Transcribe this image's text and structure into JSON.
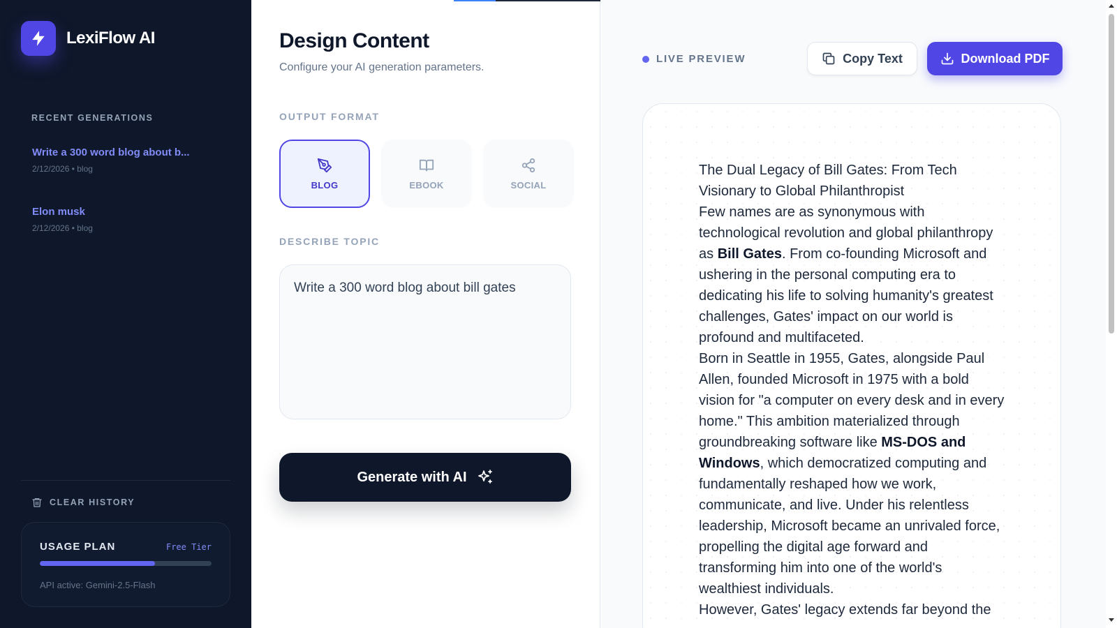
{
  "app": {
    "name": "LexiFlow AI",
    "logo_icon": "bolt-icon"
  },
  "sidebar": {
    "section_label": "RECENT GENERATIONS",
    "history": [
      {
        "title": "Write a 300 word blog about b...",
        "date": "2/12/2026",
        "type": "blog",
        "meta": "2/12/2026 • blog"
      },
      {
        "title": "Elon musk",
        "date": "2/12/2026",
        "type": "blog",
        "meta": "2/12/2026 • blog"
      }
    ],
    "clear_history_label": "CLEAR HISTORY",
    "usage": {
      "title": "USAGE PLAN",
      "tier": "Free Tier",
      "progress": 0.67,
      "api": "API active: Gemini-2.5-Flash"
    }
  },
  "config": {
    "title": "Design Content",
    "subtitle": "Configure your AI generation parameters.",
    "output_format_label": "OUTPUT FORMAT",
    "formats": [
      {
        "label": "BLOG",
        "icon": "pen-nib-icon",
        "active": true
      },
      {
        "label": "EBOOK",
        "icon": "book-icon",
        "active": false
      },
      {
        "label": "SOCIAL",
        "icon": "share-icon",
        "active": false
      }
    ],
    "topic_label": "DESCRIBE TOPIC",
    "topic_value": "Write a 300 word blog about bill gates",
    "generate_label": "Generate with AI"
  },
  "preview": {
    "live_label": "LIVE PREVIEW",
    "copy_label": "Copy Text",
    "download_label": "Download PDF",
    "doc": {
      "title": "The Dual Legacy of Bill Gates: From Tech Visionary to Global Philanthropist",
      "p1_before": "Few names are as synonymous with technological revolution and global philanthropy as ",
      "p1_bold": "Bill Gates",
      "p1_after": ". From co-founding Microsoft and ushering in the personal computing era to dedicating his life to solving humanity's greatest challenges, Gates' impact on our world is profound and multifaceted.",
      "p2_before": "Born in Seattle in 1955, Gates, alongside Paul Allen, founded Microsoft in 1975 with a bold vision for \"a computer on every desk and in every home.\" This ambition materialized through groundbreaking software like ",
      "p2_bold": "MS-DOS and Windows",
      "p2_after": ", which democratized computing and fundamentally reshaped how we work, communicate, and live. Under his relentless leadership, Microsoft became an unrivaled force, propelling the digital age forward and transforming him into one of the world's wealthiest individuals.",
      "p3": "However, Gates' legacy extends far beyond the"
    }
  },
  "colors": {
    "sidebar_bg": "#0f172a",
    "accent": "#4f46e5",
    "accent_text": "#818cf8"
  }
}
